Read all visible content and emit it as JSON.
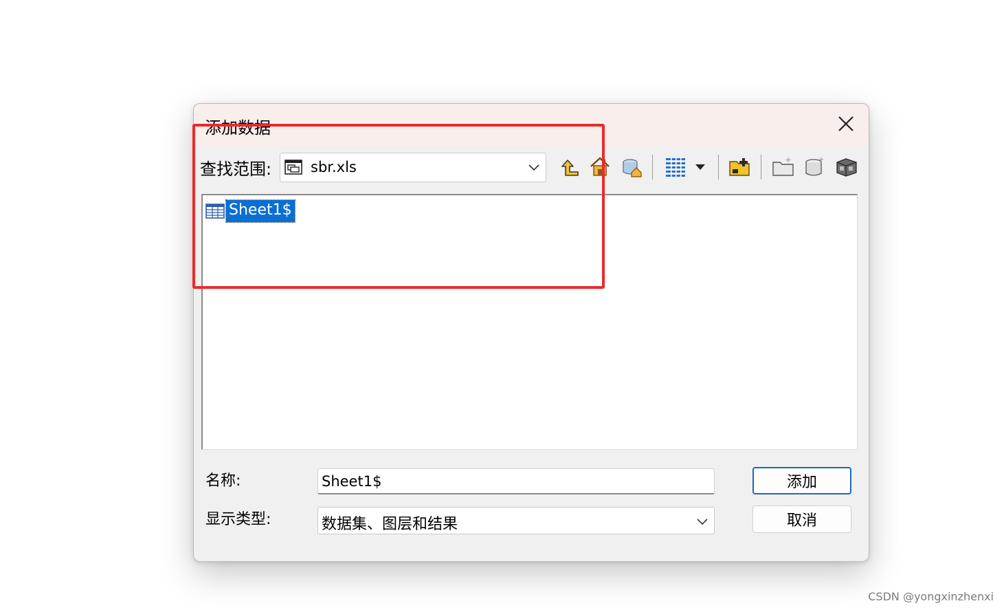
{
  "dialog": {
    "title": "添加数据",
    "look_in": {
      "label": "查找范围:",
      "value": "sbr.xls"
    },
    "toolbar": {
      "icons": [
        "up-one-level-icon",
        "home-icon",
        "default-geodatabase-icon",
        "list-view-icon",
        "view-dropdown-icon",
        "connect-folder-icon",
        "new-folder-icon",
        "new-database-icon",
        "catalog-options-icon"
      ]
    },
    "file_list": {
      "items": [
        {
          "name": "Sheet1$",
          "icon": "table-icon",
          "selected": true
        }
      ]
    },
    "name_field": {
      "label": "名称:",
      "value": "Sheet1$"
    },
    "show_type": {
      "label": "显示类型:",
      "value": "数据集、图层和结果"
    },
    "buttons": {
      "add": "添加",
      "cancel": "取消"
    }
  },
  "colors": {
    "title_bar": "#f8eeec",
    "dialog_bg": "#f0f0f0",
    "selection": "#0a6fd3",
    "annotation": "#ec2a2a",
    "default_button_border": "#1a66c4"
  },
  "watermark": "CSDN @yongxinzhenxi"
}
